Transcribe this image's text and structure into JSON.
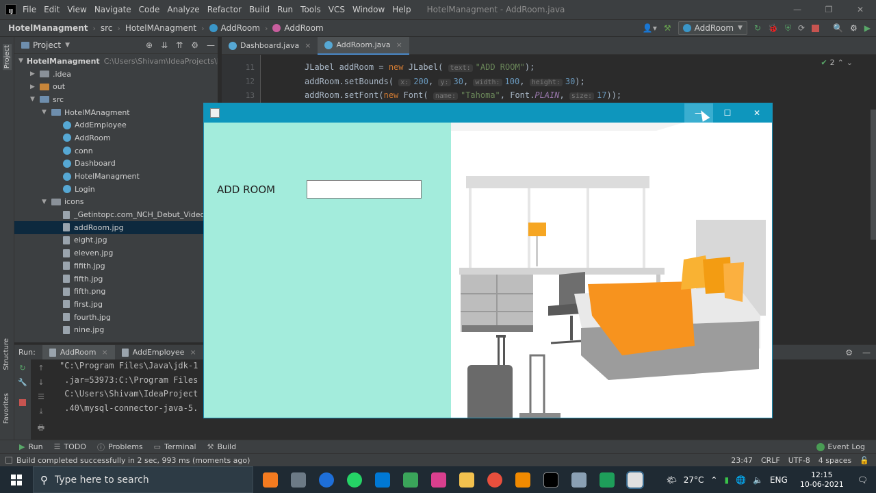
{
  "menubar": {
    "items": [
      "File",
      "Edit",
      "View",
      "Navigate",
      "Code",
      "Analyze",
      "Refactor",
      "Build",
      "Run",
      "Tools",
      "VCS",
      "Window",
      "Help"
    ],
    "title": "HotelManagment - AddRoom.java"
  },
  "navbar": {
    "crumbs": [
      "HotelManagment",
      "src",
      "HotelMAnagment",
      "AddRoom",
      "AddRoom"
    ],
    "run_config": "AddRoom"
  },
  "project": {
    "header": "Project",
    "root_name": "HotelManagment",
    "root_path": "C:\\Users\\Shivam\\IdeaProjects\\Ho",
    "tree": [
      {
        "label": ".idea",
        "level": 1,
        "kind": "folder",
        "arrow": "▶"
      },
      {
        "label": "out",
        "level": 1,
        "kind": "folder-orange",
        "arrow": "▶"
      },
      {
        "label": "src",
        "level": 1,
        "kind": "folder-blue",
        "arrow": "▼"
      },
      {
        "label": "HotelMAnagment",
        "level": 2,
        "kind": "folder-blue",
        "arrow": "▼"
      },
      {
        "label": "AddEmployee",
        "level": 3,
        "kind": "class",
        "arrow": ""
      },
      {
        "label": "AddRoom",
        "level": 3,
        "kind": "class",
        "arrow": ""
      },
      {
        "label": "conn",
        "level": 3,
        "kind": "class",
        "arrow": ""
      },
      {
        "label": "Dashboard",
        "level": 3,
        "kind": "class",
        "arrow": ""
      },
      {
        "label": "HotelManagment",
        "level": 3,
        "kind": "class",
        "arrow": ""
      },
      {
        "label": "Login",
        "level": 3,
        "kind": "class",
        "arrow": ""
      },
      {
        "label": "icons",
        "level": 2,
        "kind": "folder",
        "arrow": "▼"
      },
      {
        "label": "_Getintopc.com_NCH_Debut_Video_C",
        "level": 3,
        "kind": "file",
        "arrow": ""
      },
      {
        "label": "addRoom.jpg",
        "level": 3,
        "kind": "file",
        "arrow": "",
        "selected": true
      },
      {
        "label": "eight.jpg",
        "level": 3,
        "kind": "file",
        "arrow": ""
      },
      {
        "label": "eleven.jpg",
        "level": 3,
        "kind": "file",
        "arrow": ""
      },
      {
        "label": "fifith.jpg",
        "level": 3,
        "kind": "file",
        "arrow": ""
      },
      {
        "label": "fifth.jpg",
        "level": 3,
        "kind": "file",
        "arrow": ""
      },
      {
        "label": "fifth.png",
        "level": 3,
        "kind": "file",
        "arrow": ""
      },
      {
        "label": "first.jpg",
        "level": 3,
        "kind": "file",
        "arrow": ""
      },
      {
        "label": "fourth.jpg",
        "level": 3,
        "kind": "file",
        "arrow": ""
      },
      {
        "label": "nine.jpg",
        "level": 3,
        "kind": "file",
        "arrow": ""
      }
    ]
  },
  "editor": {
    "tabs": [
      "Dashboard.java",
      "AddRoom.java"
    ],
    "active_tab": 1,
    "warnings": "2",
    "lines": [
      {
        "num": "11",
        "html": "JLabel addRoom = <span class='kw'>new</span> JLabel( <span class='hint'>text:</span><span class='str'>\"ADD ROOM\"</span>);"
      },
      {
        "num": "12",
        "html": "addRoom.setBounds( <span class='hint'>x:</span><span class='num'>200</span>, <span class='hint'>y:</span><span class='num'>30</span>, <span class='hint'>width:</span><span class='num'>100</span>, <span class='hint'>height:</span><span class='num'>30</span>);"
      },
      {
        "num": "13",
        "html": "addRoom.setFont(<span class='kw'>new</span> Font( <span class='hint'>name:</span><span class='str'>\"Tahoma\"</span>, Font.<span class='it'>PLAIN</span>, <span class='hint'>size:</span><span class='num'>17</span>));"
      }
    ]
  },
  "run": {
    "label": "Run:",
    "tabs": [
      "AddRoom",
      "AddEmployee"
    ],
    "console": [
      "\"C:\\Program Files\\Java\\jdk-1",
      " .jar=53973:C:\\Program Files",
      " C:\\Users\\Shivam\\IdeaProject",
      " .40\\mysql-connector-java-5."
    ]
  },
  "bottom_tools": [
    "Run",
    "TODO",
    "Problems",
    "Terminal",
    "Build"
  ],
  "event_log": "Event Log",
  "status": {
    "message": "Build completed successfully in 2 sec, 993 ms (moments ago)",
    "position": "23:47",
    "line_sep": "CRLF",
    "encoding": "UTF-8",
    "indent": "4 spaces"
  },
  "left_stripe": [
    "Project",
    "Structure",
    "Favorites"
  ],
  "swing": {
    "label": "ADD ROOM",
    "input_value": "",
    "minimize": "—",
    "maximize": "☐",
    "close": "✕"
  },
  "taskbar": {
    "search_placeholder": "Type here to search",
    "weather": "27°C",
    "lang": "ENG",
    "time": "12:15",
    "date": "10-06-2021"
  }
}
